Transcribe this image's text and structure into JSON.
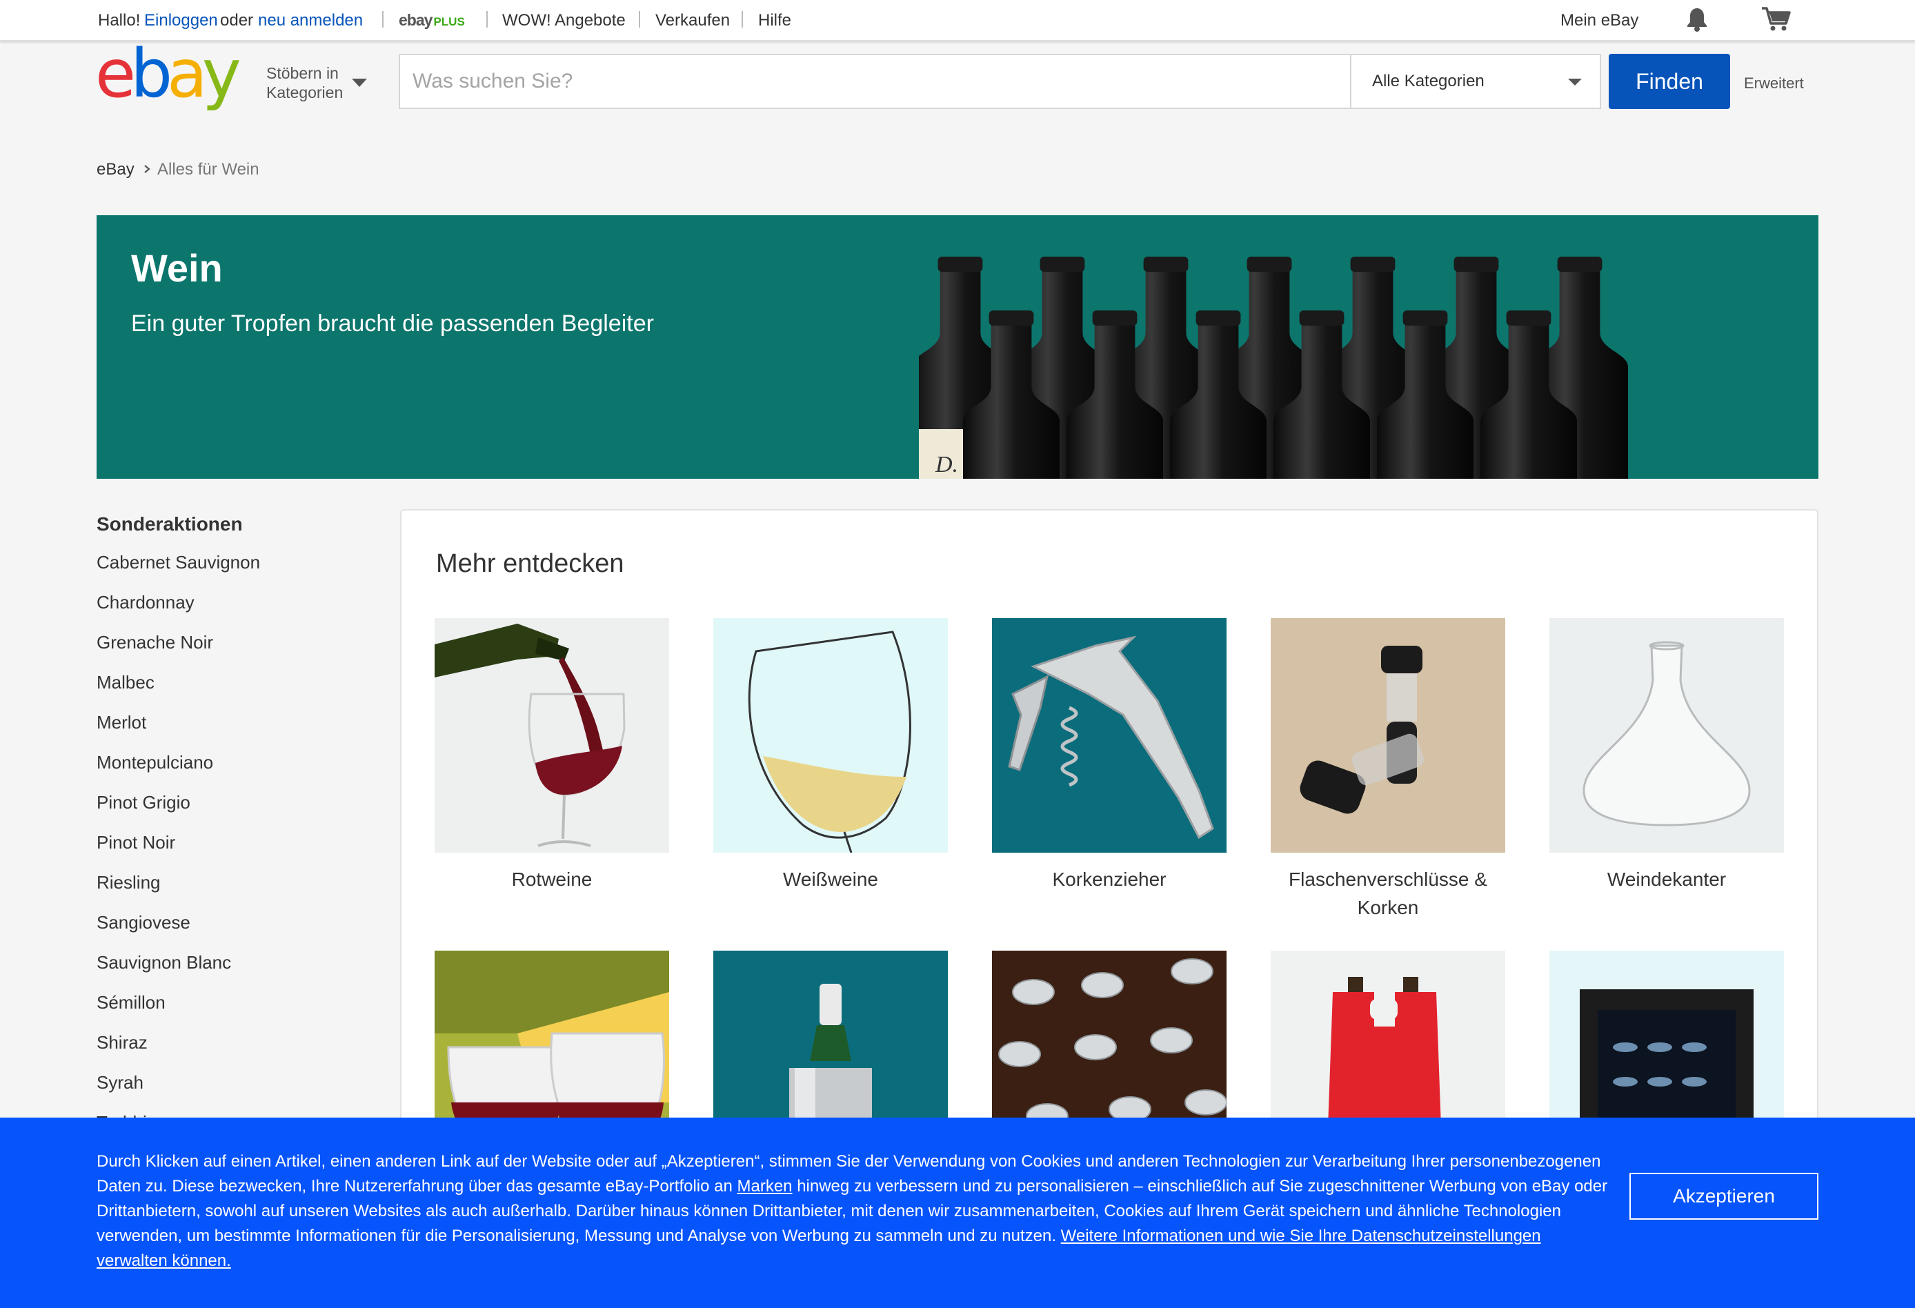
{
  "topbar": {
    "greeting": "Hallo!",
    "signin": "Einloggen",
    "or": "oder",
    "register": "neu anmelden",
    "ebay_plus_ebay": "ebay",
    "ebay_plus_plus": "PLUS",
    "deals": "WOW! Angebote",
    "sell": "Verkaufen",
    "help": "Hilfe",
    "my_ebay": "Mein eBay"
  },
  "header": {
    "browse_line1": "Stöbern in",
    "browse_line2": "Kategorien",
    "search_placeholder": "Was suchen Sie?",
    "category_value": "Alle Kategorien",
    "find": "Finden",
    "advanced": "Erweitert"
  },
  "breadcrumb": {
    "home": "eBay",
    "current": "Alles für Wein"
  },
  "hero": {
    "title": "Wein",
    "subtitle": "Ein guter Tropfen braucht die passenden Begleiter",
    "bottle_label": "D."
  },
  "sidebar": {
    "title": "Sonderaktionen",
    "items": [
      "Cabernet Sauvignon",
      "Chardonnay",
      "Grenache Noir",
      "Malbec",
      "Merlot",
      "Montepulciano",
      "Pinot Grigio",
      "Pinot Noir",
      "Riesling",
      "Sangiovese",
      "Sauvignon Blanc",
      "Sémillon",
      "Shiraz",
      "Syrah",
      "Trebbiano"
    ]
  },
  "main": {
    "title": "Mehr entdecken",
    "tiles": [
      {
        "label": "Rotweine"
      },
      {
        "label": "Weißweine"
      },
      {
        "label": "Korkenzieher"
      },
      {
        "label": "Flaschenverschlüsse & Korken"
      },
      {
        "label": "Weindekanter"
      },
      {
        "label": ""
      },
      {
        "label": ""
      },
      {
        "label": ""
      },
      {
        "label": ""
      },
      {
        "label": ""
      }
    ]
  },
  "cookie": {
    "text_before": "Durch Klicken auf einen Artikel, einen anderen Link auf der Website oder auf „Akzeptieren“, stimmen Sie der Verwendung von Cookies und anderen Technologien zur Verarbeitung Ihrer personenbezogenen Daten zu. Diese bezwecken, Ihre Nutzererfahrung über das gesamte eBay-Portfolio an ",
    "brands_link": "Marken",
    "text_middle": " hinweg zu verbessern und zu personalisieren – einschließlich auf Sie zugeschnittener Werbung von eBay oder Drittanbietern, sowohl auf unseren Websites als auch außerhalb. Darüber hinaus können Drittanbieter, mit denen wir zusammenarbeiten, Cookies auf Ihrem Gerät speichern und ähnliche Technologien verwenden, um bestimmte Informationen für die Personalisierung, Messung und Analyse von Werbung zu sammeln und zu nutzen. ",
    "more_link": "Weitere Informationen und wie Sie Ihre Datenschutzeinstellungen verwalten können.",
    "accept": "Akzeptieren"
  },
  "colors": {
    "link_blue": "#0654ba",
    "find_button": "#0654ba",
    "hero_teal": "#0c756c",
    "cookie_blue": "#0654fb",
    "ebay_red": "#e53238",
    "ebay_blue": "#0064d2",
    "ebay_yellow": "#f5af02",
    "ebay_green": "#86b817"
  },
  "icons": [
    "bell-icon",
    "cart-icon",
    "chevron-down-icon",
    "chevron-right-icon"
  ]
}
